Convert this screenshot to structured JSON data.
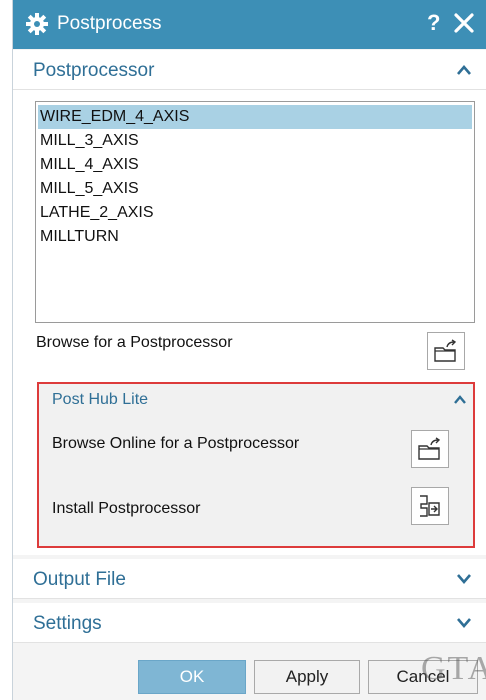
{
  "colors": {
    "titlebar": "#3d8fb6",
    "accent_text": "#2f6f96",
    "selection": "#a9d1e4",
    "highlight_border": "#dd3b3b"
  },
  "window": {
    "title": "Postprocess",
    "help_label": "?",
    "icons": {
      "settings": "gear-icon",
      "close": "close-icon"
    }
  },
  "postprocessor": {
    "header": "Postprocessor",
    "expanded": true,
    "list": [
      {
        "label": "WIRE_EDM_4_AXIS",
        "selected": true
      },
      {
        "label": "MILL_3_AXIS",
        "selected": false
      },
      {
        "label": "MILL_4_AXIS",
        "selected": false
      },
      {
        "label": "MILL_5_AXIS",
        "selected": false
      },
      {
        "label": "LATHE_2_AXIS",
        "selected": false
      },
      {
        "label": "MILLTURN",
        "selected": false
      }
    ],
    "browse_label": "Browse for a Postprocessor"
  },
  "post_hub": {
    "header": "Post Hub Lite",
    "expanded": true,
    "browse_online_label": "Browse Online for a Postprocessor",
    "install_label": "Install Postprocessor"
  },
  "output_file": {
    "header": "Output File",
    "expanded": false
  },
  "settings": {
    "header": "Settings",
    "expanded": false
  },
  "buttons": {
    "ok": "OK",
    "apply": "Apply",
    "cancel": "Cancel"
  },
  "watermark": "GTA"
}
